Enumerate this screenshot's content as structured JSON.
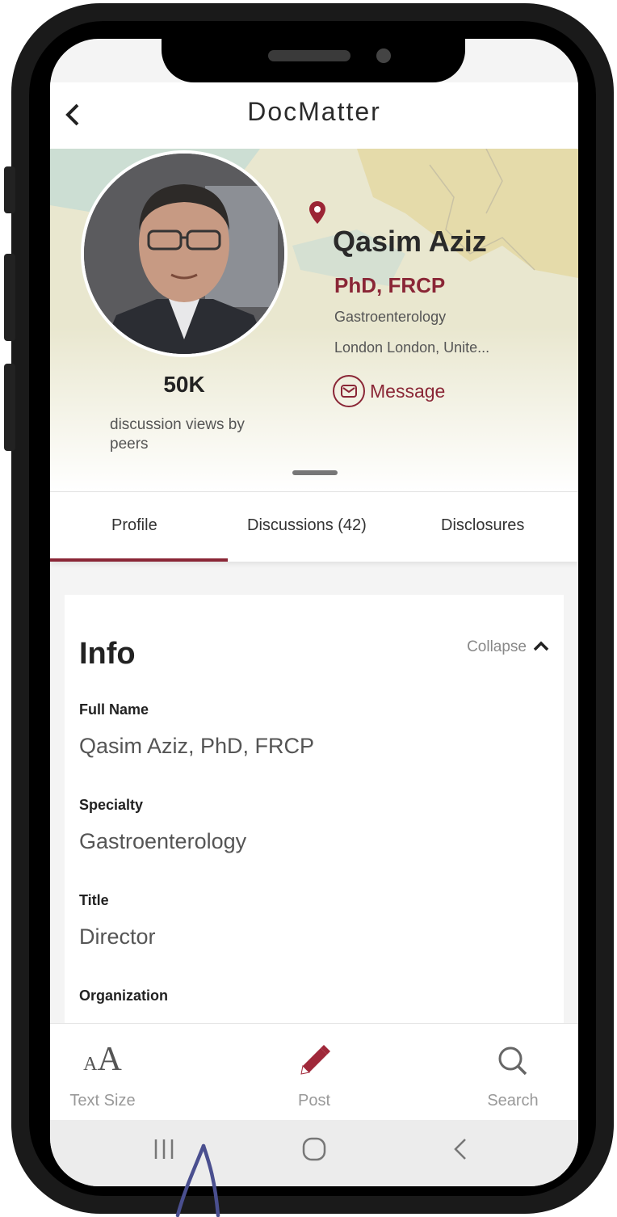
{
  "app": {
    "brand": "DocMatter"
  },
  "profile": {
    "name": "Qasim Aziz",
    "credentials": "PhD, FRCP",
    "specialty": "Gastroenterology",
    "location": "London London, Unite...",
    "message_label": "Message",
    "stat_value": "50K",
    "stat_label": "discussion views by peers"
  },
  "tabs": [
    {
      "label": "Profile",
      "active": true
    },
    {
      "label": "Discussions (42)",
      "active": false
    },
    {
      "label": "Disclosures",
      "active": false
    }
  ],
  "info": {
    "title": "Info",
    "collapse_label": "Collapse",
    "fields": [
      {
        "label": "Full Name",
        "value": "Qasim Aziz, PhD, FRCP"
      },
      {
        "label": "Specialty",
        "value": "Gastroenterology"
      },
      {
        "label": "Title",
        "value": "Director"
      },
      {
        "label": "Organization",
        "value": ""
      }
    ]
  },
  "toolbar": {
    "text_size_label": "Text Size",
    "post_label": "Post",
    "search_label": "Search"
  },
  "colors": {
    "accent": "#8a2636",
    "tab_underline": "#8a2636",
    "annotation_arrow": "#4a4f8f"
  }
}
